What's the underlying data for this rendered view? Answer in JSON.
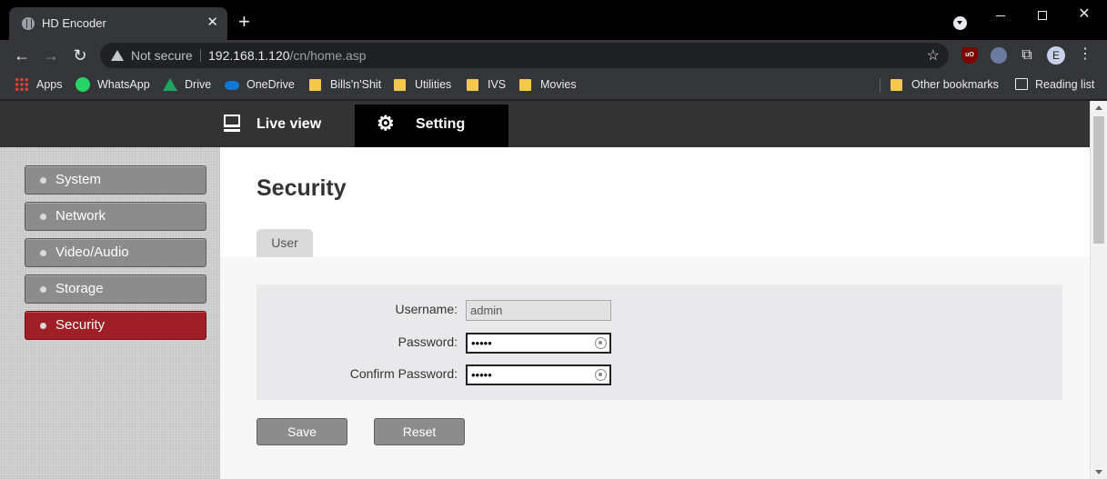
{
  "browser": {
    "tab_title": "HD Encoder",
    "tab_close": "✕",
    "new_tab": "+",
    "not_secure": "Not secure",
    "url_host": "192.168.1.120",
    "url_path": "/cn/home.asp",
    "profile_initial": "E",
    "extensions": [
      "ublock-origin-icon",
      "spy-extension-icon",
      "puzzle-icon"
    ],
    "ublock_label": "uO",
    "window_controls": {
      "close": "✕"
    }
  },
  "bookmarks": [
    {
      "label": "Apps",
      "icon": "apps-grid-icon"
    },
    {
      "label": "WhatsApp",
      "icon": "whatsapp-icon"
    },
    {
      "label": "Drive",
      "icon": "google-drive-icon"
    },
    {
      "label": "OneDrive",
      "icon": "onedrive-icon"
    },
    {
      "label": "Bills'n'Shit",
      "icon": "folder-icon"
    },
    {
      "label": "Utilities",
      "icon": "folder-icon"
    },
    {
      "label": "IVS",
      "icon": "folder-icon"
    },
    {
      "label": "Movies",
      "icon": "folder-icon"
    }
  ],
  "bookmarks_right": {
    "other": "Other bookmarks",
    "reading_list": "Reading list"
  },
  "topnav": {
    "live_view": "Live view",
    "setting": "Setting"
  },
  "sidebar": {
    "items": [
      {
        "label": "System",
        "active": false
      },
      {
        "label": "Network",
        "active": false
      },
      {
        "label": "Video/Audio",
        "active": false
      },
      {
        "label": "Storage",
        "active": false
      },
      {
        "label": "Security",
        "active": true
      }
    ]
  },
  "main": {
    "title": "Security",
    "subtab": "User",
    "form": {
      "username_label": "Username:",
      "username_value": "admin",
      "password_label": "Password:",
      "password_value": "•••••",
      "confirm_label": "Confirm Password:",
      "confirm_value": "•••••"
    },
    "save_label": "Save",
    "reset_label": "Reset"
  },
  "colors": {
    "active_menu": "#a01e25",
    "menu_button": "#8c8c8c",
    "topnav_bg": "#333333",
    "topnav_active": "#000000"
  }
}
